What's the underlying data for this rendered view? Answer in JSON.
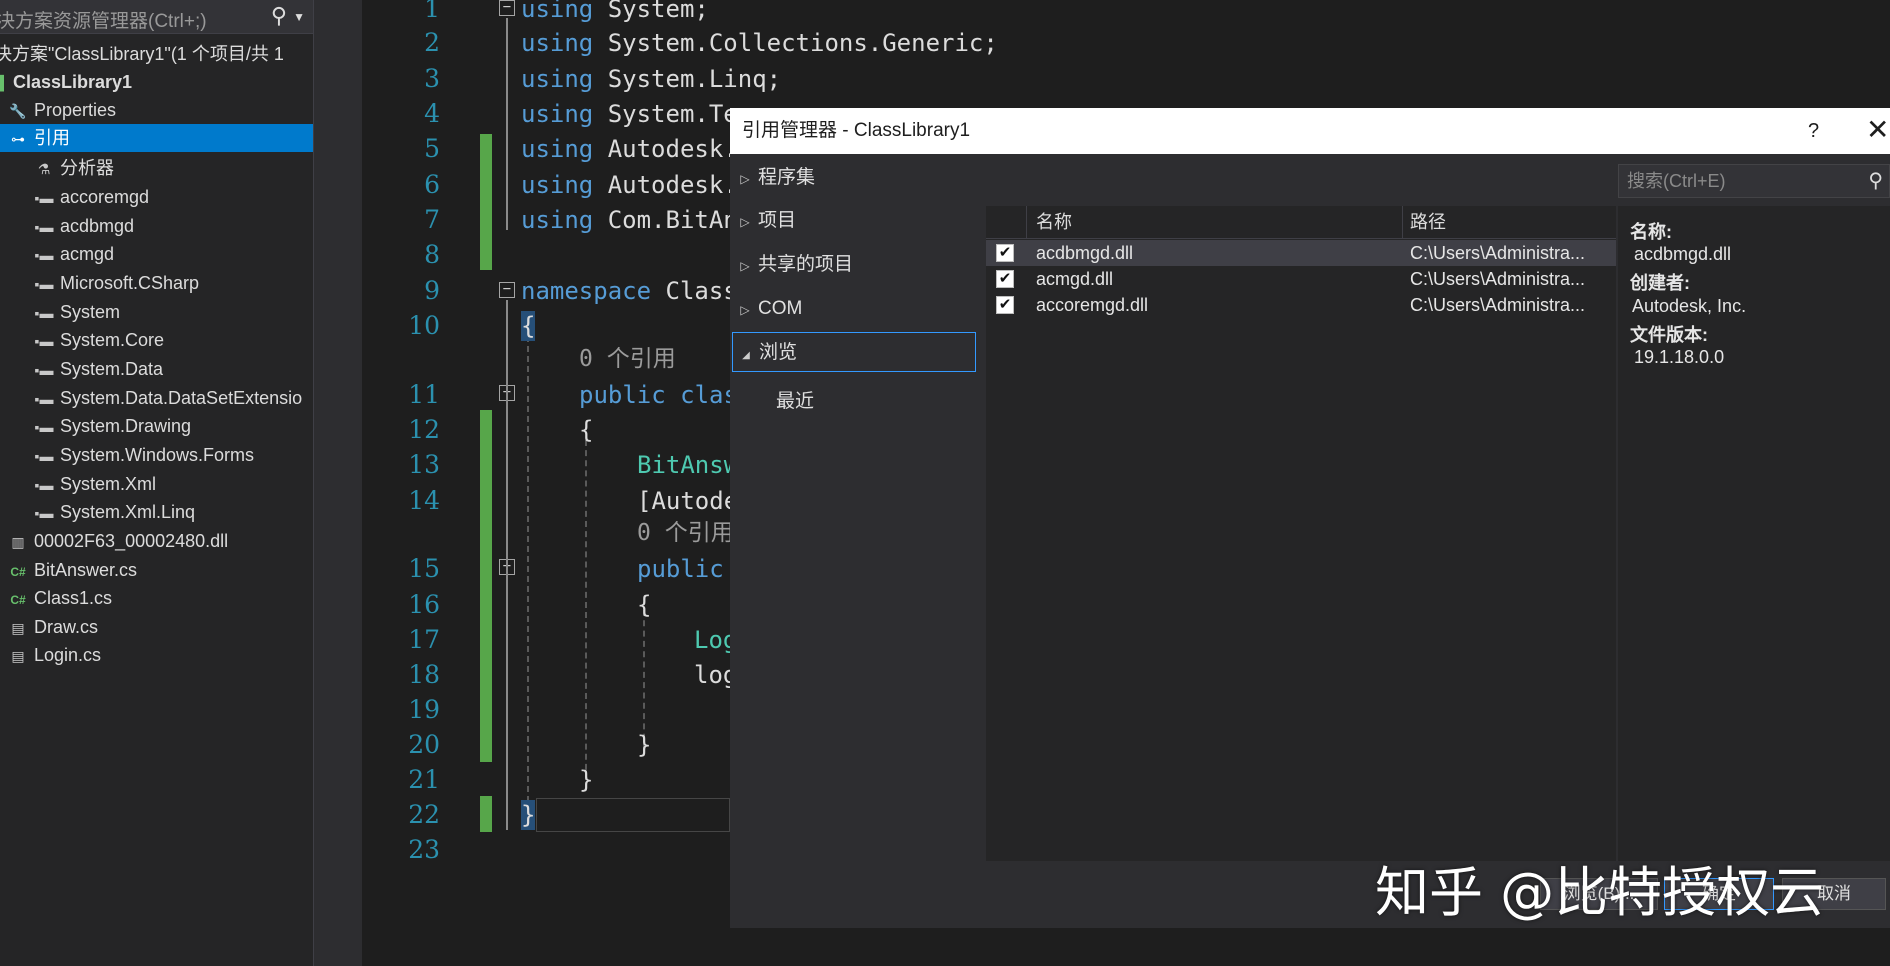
{
  "solution_explorer": {
    "search_placeholder": "决方案资源管理器(Ctrl+;)",
    "items": [
      {
        "label": "决方案\"ClassLibrary1\"(1 个项目/共 1",
        "icon": "solution-icon"
      },
      {
        "label": "ClassLibrary1",
        "icon": "project-icon"
      },
      {
        "label": "Properties",
        "icon": "wrench-icon"
      },
      {
        "label": "引用",
        "icon": "references-icon"
      },
      {
        "label": "分析器",
        "icon": "analyzer-icon"
      },
      {
        "label": "accoremgd",
        "icon": "reference-icon"
      },
      {
        "label": "acdbmgd",
        "icon": "reference-icon"
      },
      {
        "label": "acmgd",
        "icon": "reference-icon"
      },
      {
        "label": "Microsoft.CSharp",
        "icon": "reference-icon"
      },
      {
        "label": "System",
        "icon": "reference-icon"
      },
      {
        "label": "System.Core",
        "icon": "reference-icon"
      },
      {
        "label": "System.Data",
        "icon": "reference-icon"
      },
      {
        "label": "System.Data.DataSetExtensio",
        "icon": "reference-icon"
      },
      {
        "label": "System.Drawing",
        "icon": "reference-icon"
      },
      {
        "label": "System.Windows.Forms",
        "icon": "reference-icon"
      },
      {
        "label": "System.Xml",
        "icon": "reference-icon"
      },
      {
        "label": "System.Xml.Linq",
        "icon": "reference-icon"
      },
      {
        "label": "00002F63_00002480.dll",
        "icon": "library-icon"
      },
      {
        "label": "BitAnswer.cs",
        "icon": "csharp-file-icon"
      },
      {
        "label": "Class1.cs",
        "icon": "csharp-file-icon"
      },
      {
        "label": "Draw.cs",
        "icon": "form-file-icon"
      },
      {
        "label": "Login.cs",
        "icon": "form-file-icon"
      }
    ]
  },
  "editor": {
    "line_numbers": [
      "1",
      "2",
      "3",
      "4",
      "5",
      "6",
      "7",
      "8",
      "9",
      "10",
      "11",
      "12",
      "13",
      "14",
      "15",
      "16",
      "17",
      "18",
      "19",
      "20",
      "21",
      "22",
      "23"
    ],
    "code": {
      "l1_kw": "using",
      "l1_rest": " System;",
      "l2_kw": "using",
      "l2_rest": " System.Collections.Generic;",
      "l3_kw": "using",
      "l3_rest": " System.Linq;",
      "l4_kw": "using",
      "l4_rest": " System.Te",
      "l5_kw": "using",
      "l5_rest": " Autodesk.",
      "l6_kw": "using",
      "l6_rest": " Autodesk.",
      "l7_kw": "using",
      "l7_rest": " Com.BitAn",
      "l9_kw": "namespace",
      "l9_rest": " Class",
      "l10": "{",
      "ref0a": "0 个引用",
      "l11_kw": "public",
      "l11_rest": " clas",
      "l12": "{",
      "l13_ty": "BitAnsw",
      "l14": "[Autode",
      "ref0b": "0 个引用",
      "l15_kw": "public",
      "l16": "{",
      "l17_ty": "Log",
      "l18": "log",
      "l20": "}",
      "l21": "}",
      "l22": "}"
    }
  },
  "dialog": {
    "title": "引用管理器 - ClassLibrary1",
    "help": "?",
    "close": "✕",
    "nav": [
      {
        "label": "程序集",
        "arrow": "▷"
      },
      {
        "label": "项目",
        "arrow": "▷"
      },
      {
        "label": "共享的项目",
        "arrow": "▷"
      },
      {
        "label": "COM",
        "arrow": "▷"
      },
      {
        "label": "浏览",
        "arrow": "◢"
      },
      {
        "label": "最近",
        "arrow": ""
      }
    ],
    "search_placeholder": "搜索(Ctrl+E)",
    "columns": {
      "name": "名称",
      "path": "路径"
    },
    "rows": [
      {
        "name": "acdbmgd.dll",
        "path": "C:\\Users\\Administra...",
        "checked": "✔"
      },
      {
        "name": "acmgd.dll",
        "path": "C:\\Users\\Administra...",
        "checked": "✔"
      },
      {
        "name": "accoremgd.dll",
        "path": "C:\\Users\\Administra...",
        "checked": "✔"
      }
    ],
    "details": {
      "name_label": "名称:",
      "name_value": "acdbmgd.dll",
      "creator_label": "创建者:",
      "creator_value": "Autodesk, Inc.",
      "version_label": "文件版本:",
      "version_value": "19.1.18.0.0"
    },
    "buttons": {
      "browse": "浏览(B)...",
      "ok": "确定",
      "cancel": "取消"
    }
  },
  "watermark": "知乎 @比特授权云"
}
